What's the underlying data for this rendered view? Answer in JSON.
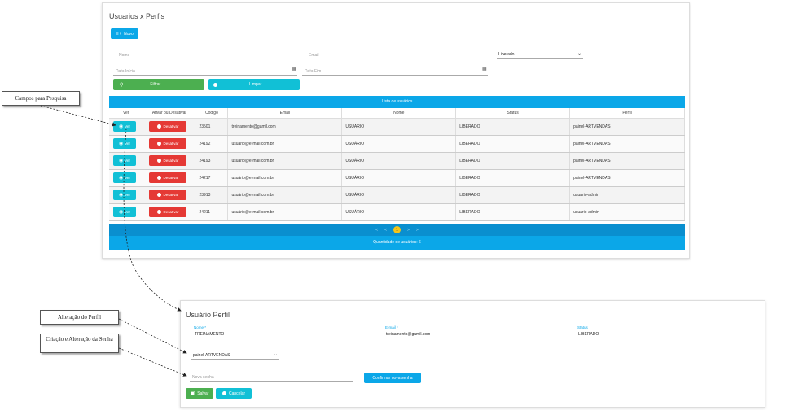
{
  "list_page": {
    "title": "Usuarios x Perfis",
    "new_button": "Novo",
    "filters": {
      "nome_placeholder": "Nome",
      "email_placeholder": "Email",
      "status_selected": "Liberado",
      "data_inicio_placeholder": "Data Início",
      "data_fim_placeholder": "Data Fim",
      "filtrar_button": "Filtrar",
      "limpar_button": "Limpar"
    },
    "table": {
      "caption": "Lista de usuários",
      "columns": [
        "Ver",
        "Ativar ou Desativar",
        "Código",
        "Email",
        "Nome",
        "Status",
        "Perfil"
      ],
      "ver_label": "Ver",
      "desativar_label": "Desativar",
      "rows": [
        {
          "codigo": "23501",
          "email": "treinamento@gamil.com",
          "nome": "USUÁRIO",
          "status": "LIBERADO",
          "perfil": "painel-ARTVENDAS"
        },
        {
          "codigo": "24192",
          "email": "usuário@e-mail.com.br",
          "nome": "USUÁRIO",
          "status": "LIBERADO",
          "perfil": "painel-ARTVENDAS"
        },
        {
          "codigo": "24193",
          "email": "usuário@e-mail.com.br",
          "nome": "USUÁRIO",
          "status": "LIBERADO",
          "perfil": "painel-ARTVENDAS"
        },
        {
          "codigo": "24217",
          "email": "usuário@e-mail.com.br",
          "nome": "USUÁRIO",
          "status": "LIBERADO",
          "perfil": "painel-ARTVENDAS"
        },
        {
          "codigo": "23913",
          "email": "usuário@e-mail.com.br",
          "nome": "USUÁRIO",
          "status": "LIBERADO",
          "perfil": "usuario-admin"
        },
        {
          "codigo": "24211",
          "email": "usuário@e-mail.com.br",
          "nome": "USUÁRIO",
          "status": "LIBERADO",
          "perfil": "usuario-admin"
        }
      ],
      "pagination": {
        "first": "|<",
        "prev": "<",
        "current": "1",
        "next": ">",
        "last": ">|"
      },
      "footer": "Quantidade de usuários: 6"
    }
  },
  "detail_page": {
    "title": "Usuário Perfil",
    "nome_label": "Nome *",
    "nome_value": "TREINAMENTO",
    "email_label": "E-mail *",
    "email_value": "treinamento@gamil.com",
    "status_label": "Status",
    "status_value": "LIBERADO",
    "perfil_selected": "painel-ARTVENDAS",
    "senha_placeholder": "Nova senha",
    "confirmar_button": "Confirmar nova senha",
    "salvar_button": "Salvar",
    "cancelar_button": "Cancelar"
  },
  "callouts": {
    "pesquisa": "Campos para Pesquisa",
    "perfil": "Alteração do Perfil",
    "senha": "Criação e Alteração da Senha"
  },
  "colors": {
    "primary": "#0ba7e8",
    "green": "#4caf50",
    "cyan": "#11c0d6",
    "red": "#e53935",
    "page_current": "#f5c518"
  }
}
